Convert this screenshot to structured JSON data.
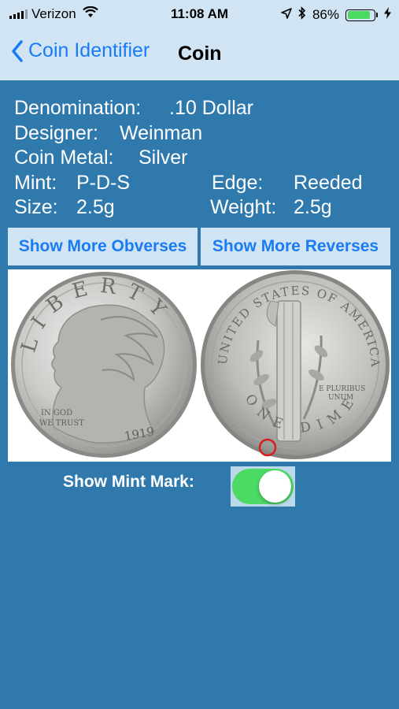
{
  "status_bar": {
    "carrier": "Verizon",
    "time": "11:08 AM",
    "battery_percent": "86%",
    "battery_level": 0.86,
    "icons": [
      "signal-icon",
      "wifi-icon",
      "location-arrow-icon",
      "bluetooth-icon",
      "battery-icon",
      "charging-bolt-icon"
    ]
  },
  "nav": {
    "back_label": "Coin Identifier",
    "title": "Coin"
  },
  "coin": {
    "denomination_label": "Denomination:",
    "denomination_value": ".10 Dollar",
    "designer_label": "Designer:",
    "designer_value": "Weinman",
    "metal_label": "Coin Metal:",
    "metal_value": "Silver",
    "mint_label": "Mint:",
    "mint_value": "P-D-S",
    "edge_label": "Edge:",
    "edge_value": "Reeded",
    "size_label": "Size:",
    "size_value": "2.5g",
    "weight_label": "Weight:",
    "weight_value": "2.5g"
  },
  "buttons": {
    "obverses": "Show More Obverses",
    "reverses": "Show More Reverses"
  },
  "coin_image": {
    "obverse_text": [
      "LIBERTY",
      "IN GOD",
      "WE TRUST",
      "1919"
    ],
    "reverse_text": [
      "UNITED STATES OF AMERICA",
      "E PLURIBUS",
      "UNUM",
      "ONE DIME"
    ]
  },
  "mint_mark": {
    "label": "Show Mint Mark:",
    "enabled": true
  },
  "colors": {
    "background": "#2f79ad",
    "bar": "#d0e4f4",
    "accent": "#1a7cf5",
    "toggle_on": "#4cd964"
  }
}
